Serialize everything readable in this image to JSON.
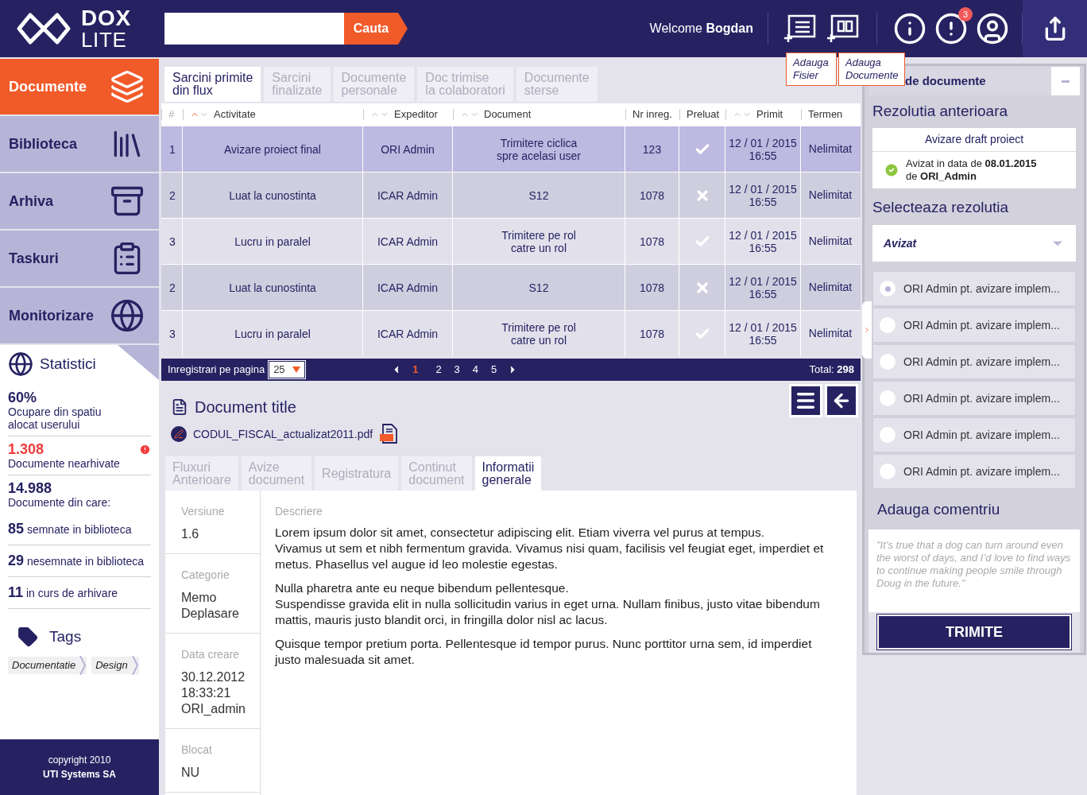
{
  "header": {
    "logo": {
      "line1": "DOX",
      "line2": "LITE"
    },
    "search_button": "Cauta",
    "welcome": "Welcome",
    "user": "Bogdan",
    "notifications": "3",
    "tooltips": [
      {
        "line1": "Adauga",
        "line2": "Fisier"
      },
      {
        "line1": "Adauga",
        "line2": "Documente"
      }
    ]
  },
  "sidebar": {
    "nav": [
      {
        "label": "Documente",
        "kind": "layers",
        "selected": true
      },
      {
        "label": "Biblioteca",
        "kind": "books",
        "selected": false
      },
      {
        "label": "Arhiva",
        "kind": "cabinet",
        "selected": false
      },
      {
        "label": "Taskuri",
        "kind": "tasks",
        "selected": false
      },
      {
        "label": "Monitorizare",
        "kind": "globe",
        "selected": false
      }
    ],
    "stats": {
      "title": "Statistici",
      "items": [
        {
          "value": "60%",
          "label": "Ocupare din spatiu alocat userului",
          "kind": "block",
          "alert": false
        },
        {
          "value": "1.308",
          "label": "Documente nearhivate",
          "kind": "block",
          "alert": true
        },
        {
          "value": "14.988",
          "label": "Documente din care:",
          "kind": "block",
          "alert": false
        },
        {
          "value": "85",
          "label": "semnate in biblioteca",
          "kind": "inline"
        },
        {
          "value": "29",
          "label": "nesemnate in biblioteca",
          "kind": "inline"
        },
        {
          "value": "11",
          "label": "in curs de arhivare",
          "kind": "inline"
        }
      ]
    },
    "tags": {
      "title": "Tags",
      "items": [
        "Documentatie",
        "Design"
      ]
    },
    "footer": [
      "copyright 2010",
      "UTI Systems SA"
    ]
  },
  "main": {
    "tabs": [
      {
        "label": "Sarcini primite\ndin flux",
        "selected": true
      },
      {
        "label": "Sarcini\nfinalizate",
        "selected": false
      },
      {
        "label": "Documente\npersonale",
        "selected": false
      },
      {
        "label": "Doc trimise\nla colaboratori",
        "selected": false
      },
      {
        "label": "Documente\nsterse",
        "selected": false
      }
    ],
    "table": {
      "columns": [
        {
          "label": "#",
          "sortable": false
        },
        {
          "label": "Activitate",
          "sortable": true,
          "sorted": true
        },
        {
          "label": "Expeditor",
          "sortable": true,
          "sorted": false
        },
        {
          "label": "Document",
          "sortable": true,
          "sorted": false
        },
        {
          "label": "Nr inreg.",
          "sortable": false
        },
        {
          "label": "Preluat",
          "sortable": false
        },
        {
          "label": "Primit",
          "sortable": true,
          "sorted": false
        },
        {
          "label": "Termen",
          "sortable": false
        }
      ],
      "rows": [
        {
          "num": "1",
          "activity": "Avizare proiect final",
          "sender": "ORI Admin",
          "document": "Trimitere ciclica\nspre acelasi user",
          "nr": "123",
          "accepted": true,
          "date": "12 / 01 / 2015",
          "time": "16:55",
          "deadline": "Nelimitat",
          "selected": true
        },
        {
          "num": "2",
          "activity": "Luat la cunostinta",
          "sender": "ICAR Admin",
          "document": "S12",
          "nr": "1078",
          "accepted": false,
          "date": "12 / 01 / 2015",
          "time": "16:55",
          "deadline": "Nelimitat",
          "selected": false
        },
        {
          "num": "3",
          "activity": "Lucru in paralel",
          "sender": "ICAR Admin",
          "document": "Trimitere pe rol\ncatre un rol",
          "nr": "1078",
          "accepted": true,
          "date": "12 / 01 / 2015",
          "time": "16:55",
          "deadline": "Nelimitat",
          "selected": false
        },
        {
          "num": "2",
          "activity": "Luat la cunostinta",
          "sender": "ICAR Admin",
          "document": "S12",
          "nr": "1078",
          "accepted": false,
          "date": "12 / 01 / 2015",
          "time": "16:55",
          "deadline": "Nelimitat",
          "selected": false
        },
        {
          "num": "3",
          "activity": "Lucru in paralel",
          "sender": "ICAR Admin",
          "document": "Trimitere pe rol\ncatre un rol",
          "nr": "1078",
          "accepted": true,
          "date": "12 / 01 / 2015",
          "time": "16:55",
          "deadline": "Nelimitat",
          "selected": false
        }
      ]
    },
    "pagination": {
      "label": "Inregistrari pe pagina",
      "per_page": "25",
      "pages": [
        {
          "label": "1",
          "selected": true
        },
        {
          "label": "2",
          "selected": false
        },
        {
          "label": "3",
          "selected": false
        },
        {
          "label": "4",
          "selected": false
        },
        {
          "label": "5",
          "selected": false
        }
      ],
      "total_label": "Total:",
      "total": "298"
    },
    "document": {
      "title": "Document title",
      "file": "CODUL_FISCAL_actualizat2011.pdf",
      "tabs": [
        {
          "label": "Fluxuri\nAnterioare",
          "selected": false
        },
        {
          "label": "Avize\ndocument",
          "selected": false
        },
        {
          "label": "Registratura",
          "selected": false
        },
        {
          "label": "Continut\ndocument",
          "selected": false
        },
        {
          "label": "Informatii\ngenerale",
          "selected": true
        }
      ],
      "fields": [
        {
          "label": "Versiune",
          "value": "1.6"
        },
        {
          "label": "Categorie",
          "value": "Memo\nDeplasare"
        },
        {
          "label": "Data creare",
          "value": "30.12.2012\n18:33:21\nORI_admin"
        },
        {
          "label": "Blocat",
          "value": "NU"
        }
      ],
      "description": {
        "label": "Descriere",
        "paragraphs": [
          "Lorem ipsum dolor sit amet, consectetur adipiscing elit. Etiam viverra vel purus at tempus.\nVivamus ut sem et nibh fermentum gravida. Vivamus nisi quam, facilisis vel feugiat eget, imperdiet et metus. Phasellus vel augue id leo molestie egestas.",
          "Nulla pharetra ante eu neque bibendum pellentesque.\nSuspendisse gravida elit in nulla sollicitudin varius in eget urna. Nullam finibus, justo vitae bibendum mattis, mauris justo blandit orci, in fringilla dolor nisl ac lacus.",
          "Quisque tempor pretium porta. Pellentesque id tempor purus. Nunc porttitor urna sem, id imperdiet justo malesuada sit amet."
        ]
      }
    }
  },
  "panel": {
    "title": "de documente",
    "previous": {
      "heading": "Rezolutia anterioara",
      "name": "Avizare draft proiect",
      "status": "Avizat in data de **08.01.2015**\nde **ORI_Admin**"
    },
    "select": {
      "heading": "Selecteaza rezolutia",
      "value": "Avizat"
    },
    "options": [
      {
        "label": "ORI Admin pt. avizare implem...",
        "selected": true
      },
      {
        "label": "ORI Admin pt. avizare implem...",
        "selected": false
      },
      {
        "label": "ORI Admin pt. avizare implem...",
        "selected": false
      },
      {
        "label": "ORI Admin pt. avizare implem...",
        "selected": false
      },
      {
        "label": "ORI Admin pt. avizare implem...",
        "selected": false
      },
      {
        "label": "ORI Admin pt. avizare implem...",
        "selected": false
      }
    ],
    "comment": {
      "heading": "Adauga comentriu",
      "placeholder": "\"It’s true that a dog can turn around even the worst of days, and I’d love to find ways to continue making people smile through Doug in the future.\""
    },
    "submit": "TRIMITE"
  }
}
